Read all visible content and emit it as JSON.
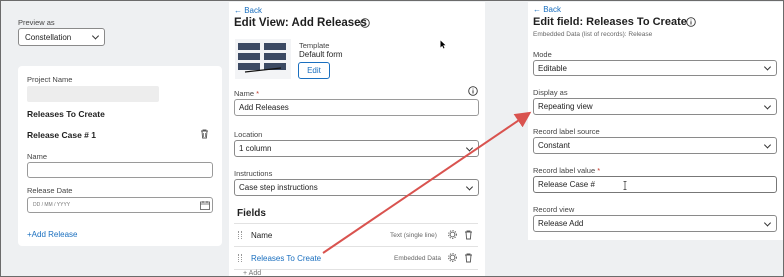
{
  "preview": {
    "label": "Preview as",
    "selected": "Constellation",
    "card": {
      "project_name_label": "Project Name",
      "section_title": "Releases To Create",
      "record_title": "Release Case # 1",
      "name_label": "Name",
      "date_label": "Release Date",
      "date_placeholder": "DD / MM / YYYY",
      "add_label": "+Add Release"
    }
  },
  "edit_view": {
    "back_label": "← Back",
    "title": "Edit View: Add Releases",
    "template_label": "Template",
    "template_value": "Default form",
    "edit_button": "Edit",
    "name_label": "Name",
    "required_mark": "*",
    "name_value": "Add Releases",
    "location_label": "Location",
    "location_value": "1 column",
    "instructions_label": "Instructions",
    "instructions_value": "Case step instructions",
    "fields_heading": "Fields",
    "fields": [
      {
        "name": "Name",
        "type": "Text (single line)"
      },
      {
        "name": "Releases To Create",
        "type": "Embedded Data"
      }
    ],
    "add_partial": "Add"
  },
  "edit_field": {
    "back_label": "← Back",
    "title": "Edit field: Releases To Create",
    "subtitle": "Embedded Data (list of records): Release",
    "mode_label": "Mode",
    "mode_value": "Editable",
    "display_label": "Display as",
    "display_value": "Repeating view",
    "source_label": "Record label source",
    "source_value": "Constant",
    "value_label": "Record label value",
    "value_value": "Release Case #",
    "view_label": "Record view",
    "view_value": "Release Add"
  },
  "colors": {
    "accent": "#1a6fbf",
    "required": "#c0392b",
    "arrow": "#d9534f"
  }
}
